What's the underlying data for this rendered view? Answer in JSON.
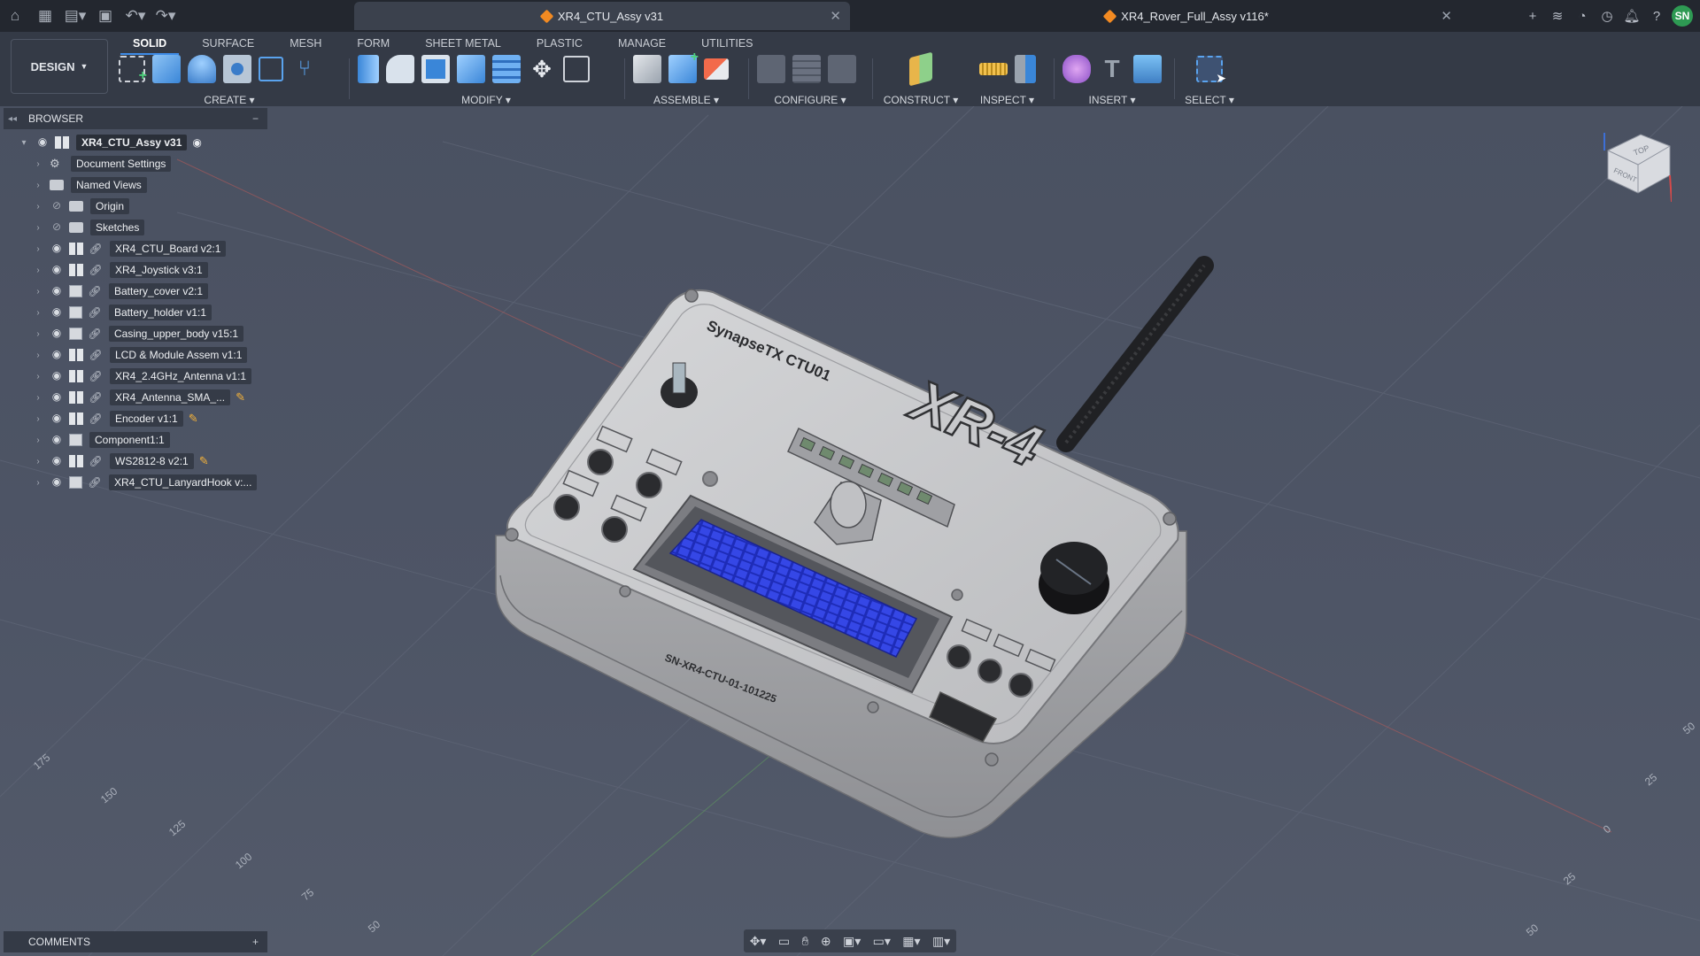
{
  "app": {
    "active_tab": "XR4_CTU_Assy v31",
    "other_tab": "XR4_Rover_Full_Assy v116*",
    "user_initials": "SN"
  },
  "toolbar": {
    "workspace": "DESIGN",
    "tabs": [
      "SOLID",
      "SURFACE",
      "MESH",
      "FORM",
      "SHEET METAL",
      "PLASTIC",
      "MANAGE",
      "UTILITIES"
    ],
    "active_tab": "SOLID",
    "groups": [
      "CREATE",
      "MODIFY",
      "ASSEMBLE",
      "CONFIGURE",
      "CONSTRUCT",
      "INSPECT",
      "INSERT",
      "SELECT"
    ]
  },
  "browser": {
    "title": "BROWSER",
    "root": "XR4_CTU_Assy v31",
    "items": [
      {
        "label": "Document Settings",
        "icon": "gear-icon",
        "link": false,
        "eye": "none"
      },
      {
        "label": "Named Views",
        "icon": "folder-icon",
        "link": false,
        "eye": "none"
      },
      {
        "label": "Origin",
        "icon": "folder-icon",
        "link": false,
        "eye": "hidden"
      },
      {
        "label": "Sketches",
        "icon": "folder-icon",
        "link": false,
        "eye": "hidden"
      },
      {
        "label": "XR4_CTU_Board v2:1",
        "icon": "assembly-icon",
        "link": true,
        "eye": "visible"
      },
      {
        "label": "XR4_Joystick v3:1",
        "icon": "assembly-icon",
        "link": true,
        "eye": "visible"
      },
      {
        "label": "Battery_cover v2:1",
        "icon": "component-icon",
        "link": true,
        "eye": "visible"
      },
      {
        "label": "Battery_holder v1:1",
        "icon": "component-icon",
        "link": true,
        "eye": "visible"
      },
      {
        "label": "Casing_upper_body v15:1",
        "icon": "component-icon",
        "link": true,
        "eye": "visible"
      },
      {
        "label": "LCD & Module Assem v1:1",
        "icon": "assembly-icon",
        "link": true,
        "eye": "visible"
      },
      {
        "label": "XR4_2.4GHz_Antenna v1:1",
        "icon": "assembly-icon",
        "link": true,
        "eye": "visible"
      },
      {
        "label": "XR4_Antenna_SMA_...",
        "icon": "assembly-icon",
        "link": true,
        "eye": "visible",
        "edit": true
      },
      {
        "label": "Encoder v1:1",
        "icon": "assembly-icon",
        "link": true,
        "eye": "visible",
        "edit": true
      },
      {
        "label": "Component1:1",
        "icon": "component-icon",
        "link": false,
        "eye": "visible"
      },
      {
        "label": "WS2812-8 v2:1",
        "icon": "assembly-icon",
        "link": true,
        "eye": "visible",
        "edit": true
      },
      {
        "label": "XR4_CTU_LanyardHook v:...",
        "icon": "component-icon",
        "link": true,
        "eye": "visible"
      }
    ]
  },
  "comments": {
    "title": "COMMENTS"
  },
  "model": {
    "brand_text": "SynapseTX CTU01",
    "logo_text": "XR-4",
    "serial_text": "SN-XR4-CTU-01-101225"
  },
  "grid_labels": [
    "175",
    "150",
    "125",
    "100",
    "75",
    "50",
    "50",
    "25",
    "0",
    "25",
    "50"
  ],
  "viewcube": {
    "face_top": "TOP",
    "face_front": "FRONT"
  },
  "colors": {
    "accent": "#3d8be6",
    "lcd": "#2e3ed6",
    "body": "#cfd0d2"
  }
}
